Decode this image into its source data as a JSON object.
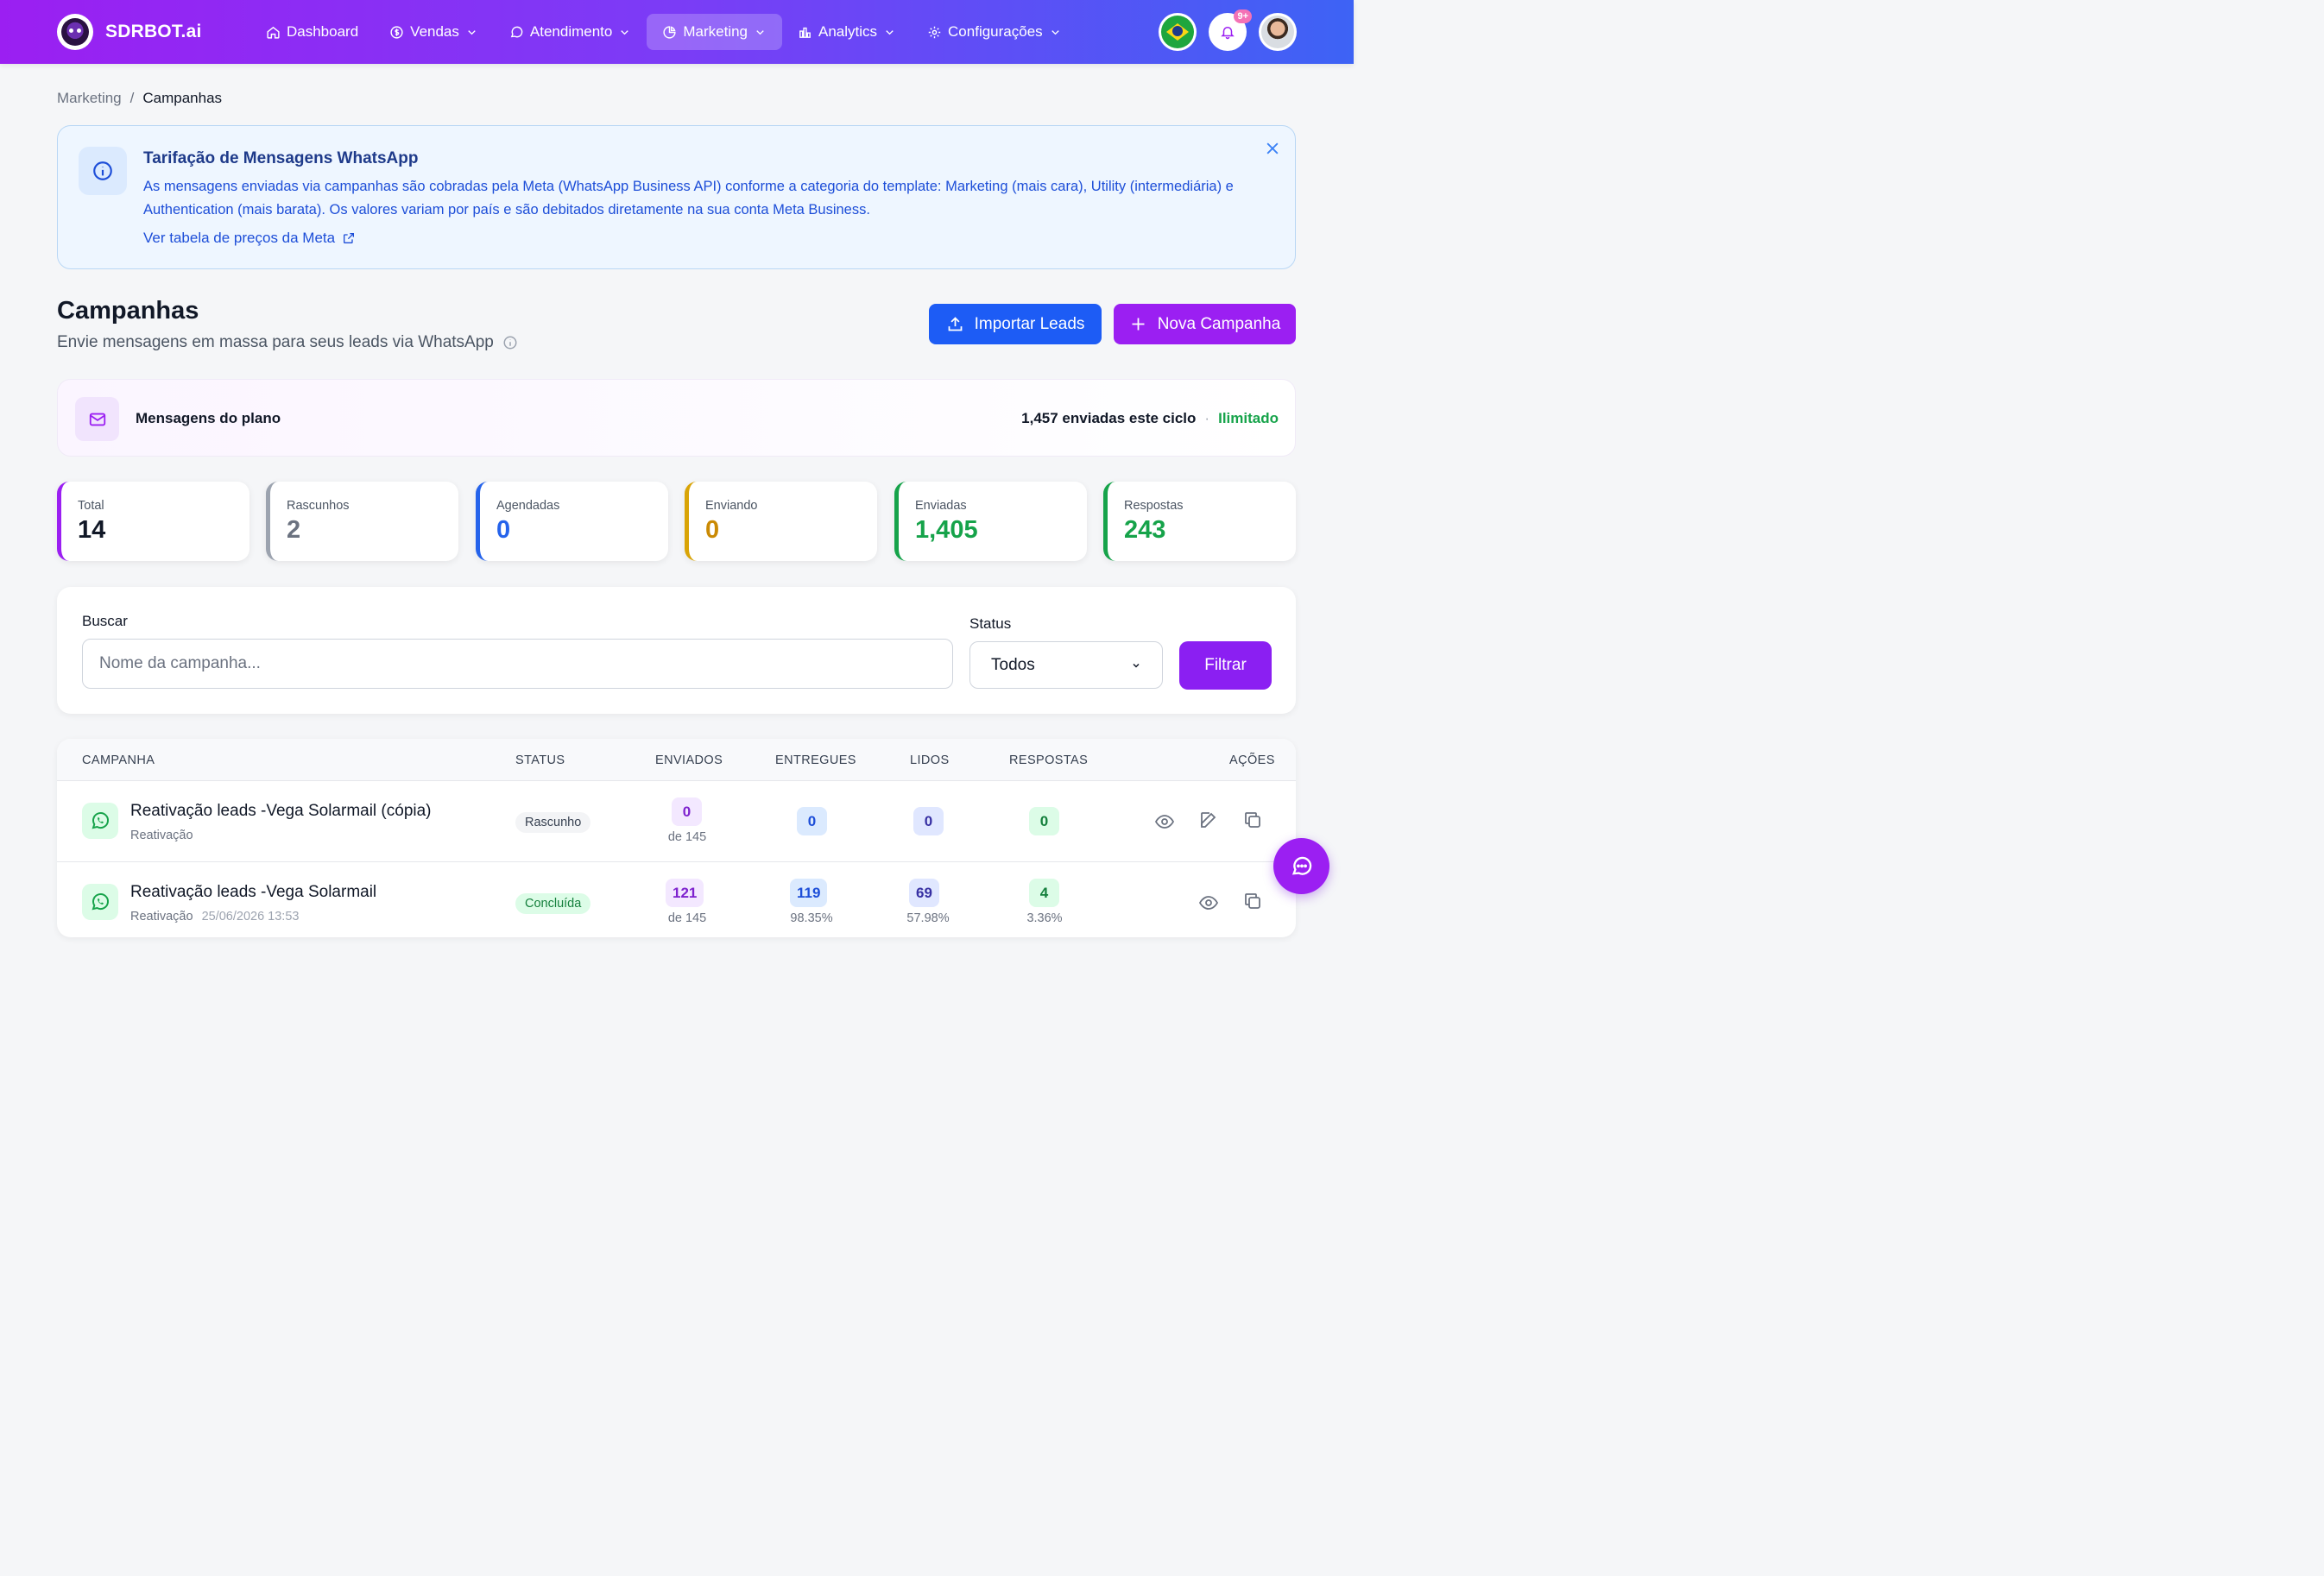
{
  "brand": {
    "name": "SDRBOT.ai"
  },
  "nav": {
    "items": [
      {
        "label": "Dashboard",
        "icon": "home-icon"
      },
      {
        "label": "Vendas",
        "icon": "dollar-icon"
      },
      {
        "label": "Atendimento",
        "icon": "chat-icon"
      },
      {
        "label": "Marketing",
        "icon": "pie-chart-icon"
      },
      {
        "label": "Analytics",
        "icon": "bar-chart-icon"
      },
      {
        "label": "Configurações",
        "icon": "gear-icon"
      }
    ],
    "active": "Marketing",
    "notifications_badge": "9+"
  },
  "breadcrumb": {
    "parent": "Marketing",
    "separator": "/",
    "current": "Campanhas"
  },
  "alert": {
    "title": "Tarifação de Mensagens WhatsApp",
    "body": "As mensagens enviadas via campanhas são cobradas pela Meta (WhatsApp Business API) conforme a categoria do template: Marketing (mais cara), Utility (intermediária) e Authentication (mais barata). Os valores variam por país e são debitados diretamente na sua conta Meta Business.",
    "link": "Ver tabela de preços da Meta"
  },
  "header": {
    "title": "Campanhas",
    "subtitle": "Envie mensagens em massa para seus leads via WhatsApp",
    "import_label": "Importar Leads",
    "new_label": "Nova Campanha"
  },
  "plan": {
    "label": "Mensagens do plano",
    "sent": "1,457 enviadas este ciclo",
    "separator": "·",
    "limit": "Ilimitado"
  },
  "stats": [
    {
      "label": "Total",
      "value": "14",
      "color": "#9b1ff2"
    },
    {
      "label": "Rascunhos",
      "value": "2",
      "color": "#9ca3af"
    },
    {
      "label": "Agendadas",
      "value": "0",
      "color": "#2563eb"
    },
    {
      "label": "Enviando",
      "value": "0",
      "color": "#ca8a04"
    },
    {
      "label": "Enviadas",
      "value": "1,405",
      "color": "#16a34a"
    },
    {
      "label": "Respostas",
      "value": "243",
      "color": "#16a34a"
    }
  ],
  "filter": {
    "search_label": "Buscar",
    "search_placeholder": "Nome da campanha...",
    "search_value": "",
    "status_label": "Status",
    "status_value": "Todos",
    "button": "Filtrar"
  },
  "table": {
    "headers": [
      "CAMPANHA",
      "STATUS",
      "ENVIADOS",
      "ENTREGUES",
      "LIDOS",
      "RESPOSTAS",
      "AÇÕES"
    ],
    "rows": [
      {
        "name": "Reativação leads -Vega Solarmail (cópia)",
        "type": "Reativação",
        "date": "",
        "status": "Rascunho",
        "sent": "0",
        "sent_sub": "de 145",
        "delivered": "0",
        "delivered_sub": "",
        "read": "0",
        "read_sub": "",
        "replies": "0",
        "replies_sub": ""
      },
      {
        "name": "Reativação leads -Vega Solarmail",
        "type": "Reativação",
        "date": "25/06/2026 13:53",
        "status": "Concluída",
        "sent": "121",
        "sent_sub": "de 145",
        "delivered": "119",
        "delivered_sub": "98.35%",
        "read": "69",
        "read_sub": "57.98%",
        "replies": "4",
        "replies_sub": "3.36%"
      }
    ]
  }
}
